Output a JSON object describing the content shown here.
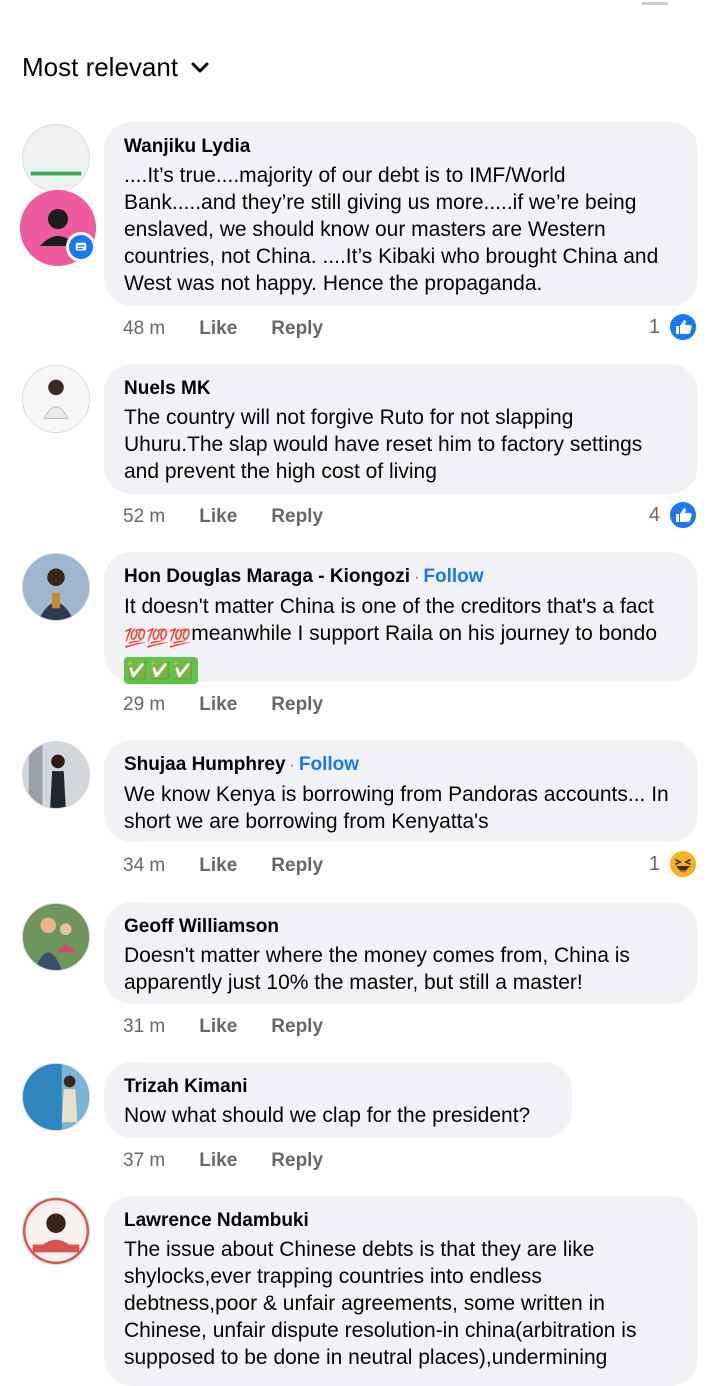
{
  "header": {
    "sort_label": "Most relevant"
  },
  "actions": {
    "like_label": "Like",
    "reply_label": "Reply"
  },
  "comments": [
    {
      "author": "Wanjiku Lydia",
      "follow": "",
      "text": "....It’s true....majority of our debt is to IMF/World Bank.....and they’re still giving us more.....if we’re being enslaved, we should know our masters are Western countries, not China. ....It’s Kibaki who brought China and West was not happy. Hence the propaganda.",
      "time": "48 m",
      "reaction_count": "1",
      "reaction_icon": "like-icon"
    },
    {
      "author": "Nuels MK",
      "follow": "",
      "text": "The country will not forgive Ruto for not slapping Uhuru.The slap would have reset him to factory settings and prevent the high cost of living",
      "time": "52 m",
      "reaction_count": "4",
      "reaction_icon": "like-icon"
    },
    {
      "author": "Hon Douglas Maraga - Kiongozi",
      "follow": "Follow",
      "text_before": "It doesn't matter China is one of the creditors that's a fact",
      "text_emoji_a": "💯💯💯",
      "text_middle": "meanwhile I support Raila on his journey to bondo ",
      "text_emoji_b": "✅✅✅",
      "time": "29 m",
      "reaction_count": "",
      "reaction_icon": ""
    },
    {
      "author": "Shujaa Humphrey",
      "follow": "Follow",
      "text": "We know Kenya is borrowing from Pandoras accounts... In short we are borrowing from Kenyatta's",
      "time": "34 m",
      "reaction_count": "1",
      "reaction_icon": "haha-icon"
    },
    {
      "author": "Geoff Williamson",
      "follow": "",
      "text": "Doesn't matter where the money comes from, China is apparently just 10% the master, but still a master!",
      "time": "31 m",
      "reaction_count": "",
      "reaction_icon": ""
    },
    {
      "author": "Trizah Kimani",
      "follow": "",
      "text": "Now what should we clap for the president?",
      "time": "37 m",
      "reaction_count": "",
      "reaction_icon": ""
    },
    {
      "author": "Lawrence Ndambuki",
      "follow": "",
      "text": "The issue about Chinese debts is that they are like shylocks,ever trapping countries into endless debtness,poor & unfair agreements, some written in Chinese, unfair dispute resolution-in china(arbitration is supposed to be done in neutral places),undermining",
      "time": "",
      "reaction_count": "",
      "reaction_icon": ""
    }
  ],
  "colors": {
    "link": "#1877f2",
    "bubble": "#f0f2f5",
    "muted": "#65676b",
    "haha": "#f7b125"
  }
}
